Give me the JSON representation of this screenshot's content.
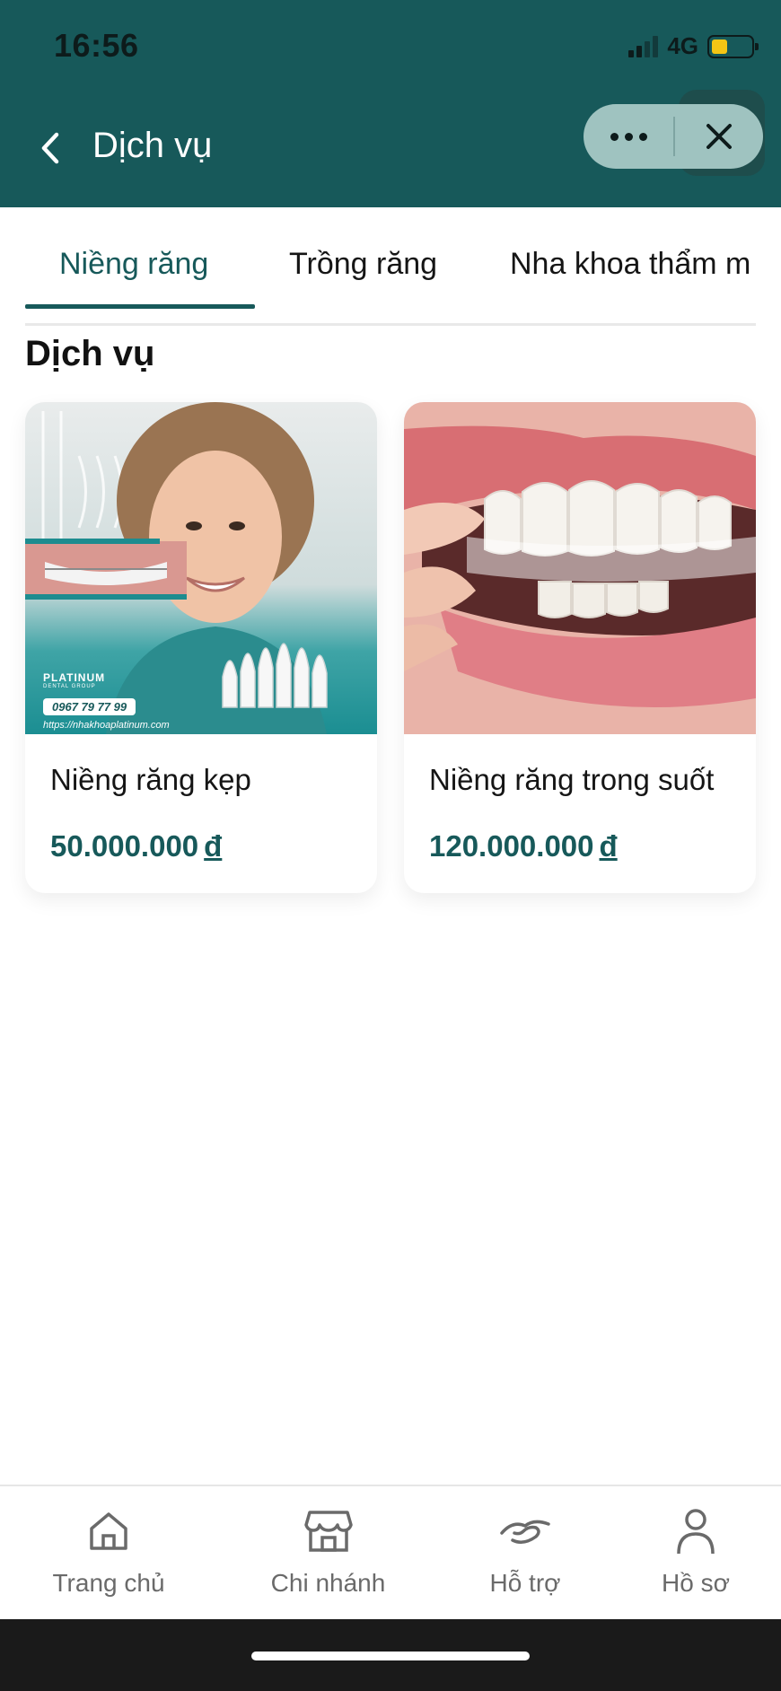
{
  "status_bar": {
    "time": "16:56",
    "network": "4G",
    "battery_level": 0.4,
    "battery_color": "#f4c515"
  },
  "header": {
    "title": "Dịch vụ",
    "back_icon": "chevron-left-icon",
    "more_icon": "more-dots-icon",
    "close_icon": "close-icon",
    "background": "#17595a"
  },
  "tabs": [
    {
      "label": "Niềng răng",
      "active": true
    },
    {
      "label": "Trồng răng",
      "active": false
    },
    {
      "label": "Nha khoa thẩm m",
      "active": false
    }
  ],
  "section": {
    "title": "Dịch vụ"
  },
  "services": [
    {
      "name": "Niềng răng kẹp",
      "price": "50.000.000",
      "currency": "đ",
      "image": {
        "brand": "PLATINUM",
        "brand_sub": "DENTAL GROUP",
        "phone": "0967 79 77 99",
        "url": "https://nhakhoaplatinum.com"
      }
    },
    {
      "name": "Niềng răng trong suốt",
      "price": "120.000.000",
      "currency": "đ",
      "image": {}
    }
  ],
  "bottom_nav": [
    {
      "label": "Trang chủ",
      "icon": "home-icon"
    },
    {
      "label": "Chi nhánh",
      "icon": "store-icon"
    },
    {
      "label": "Hỗ trợ",
      "icon": "handshake-icon"
    },
    {
      "label": "Hồ sơ",
      "icon": "profile-icon"
    }
  ],
  "accent_color": "#17595a"
}
